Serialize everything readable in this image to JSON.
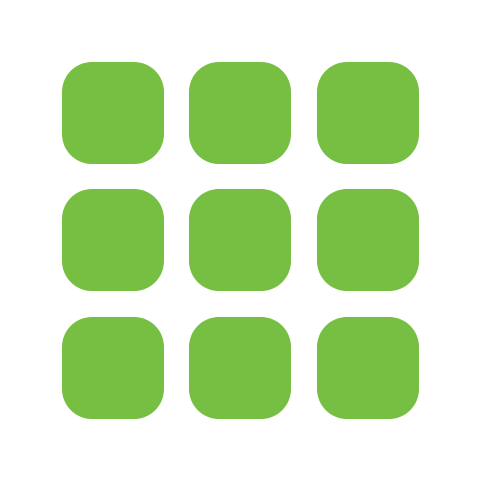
{
  "icon": {
    "name": "app-grid-icon",
    "tile_color": "#76bf43",
    "background_color": "#ffffff",
    "rows": 3,
    "columns": 3
  }
}
